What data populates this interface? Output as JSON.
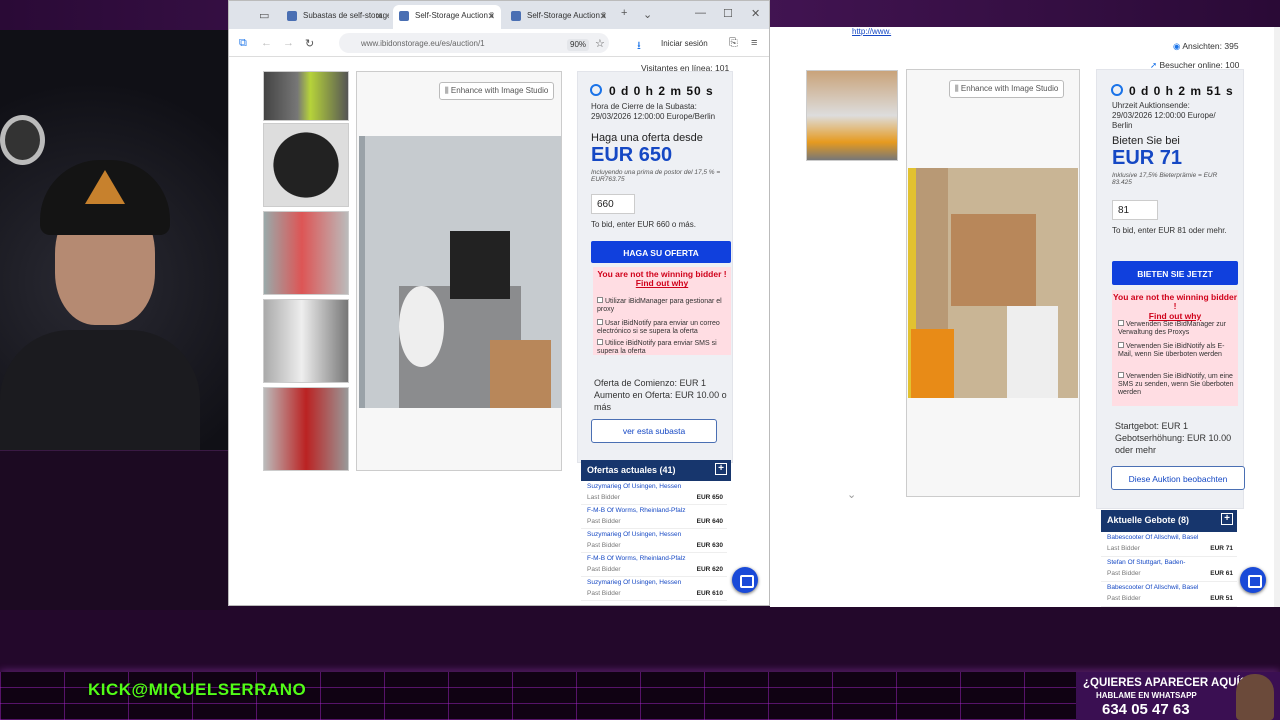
{
  "stream": {
    "overlay_handle": "KICK@MIQUELSERRANO",
    "promo": {
      "question": "¿QUIERES APARECER AQUÍ?",
      "whatsapp": "HABLAME EN WHATSAPP",
      "phone": "634 05 47 63"
    }
  },
  "browser_es": {
    "tabs": [
      {
        "label": "Subastas de self-storage"
      },
      {
        "label": "Self-Storage Auction li"
      },
      {
        "label": "Self-Storage Auction li"
      }
    ],
    "address": "www.ibidonstorage.eu/es/auction/1",
    "zoom": "90%",
    "signin": "Iniciar sesión",
    "visitors": "Visitantes en línea: 101",
    "enhance": "Enhance with Image Studio",
    "timer": "0 d 0 h 2 m 50 s",
    "close_label": "Hora de Cierre de la Subasta:",
    "close_value": "29/03/2026 12:00:00 Europe/Berlin",
    "offer_label": "Haga una oferta desde",
    "price": "EUR 650",
    "premium_note": "Incluyendo una prima de postor del 17,5 % = EUR763.75",
    "bid_input": "660",
    "bid_hint": "To bid, enter EUR 660 o más.",
    "bid_button": "HAGA SU OFERTA",
    "warning_line1": "You are not the winning bidder !",
    "warning_line2": "Find out why",
    "options": [
      "Utilizar iBidManager para gestionar el proxy",
      "Usar iBidNotify para enviar un correo electrónico si se supera la oferta",
      "Utilice iBidNotify para enviar SMS si supera la oferta"
    ],
    "start_offer": "Oferta de Comienzo: EUR 1",
    "increment": "Aumento en Oferta: EUR 10.00 o más",
    "watch_button": "ver esta subasta",
    "offers_title": "Ofertas actuales (41)",
    "offers": [
      {
        "name": "Suzymarieg Of Usingen, Hessen",
        "status": "Last Bidder",
        "amount": "EUR 650"
      },
      {
        "name": "F-M-B Of Worms, Rheinland-Pfalz",
        "status": "Past Bidder",
        "amount": "EUR 640"
      },
      {
        "name": "Suzymarieg Of Usingen, Hessen",
        "status": "Past Bidder",
        "amount": "EUR 630"
      },
      {
        "name": "F-M-B Of Worms, Rheinland-Pfalz",
        "status": "Past Bidder",
        "amount": "EUR 620"
      },
      {
        "name": "Suzymarieg Of Usingen, Hessen",
        "status": "Past Bidder",
        "amount": "EUR 610"
      }
    ]
  },
  "browser_de": {
    "link": "http://www.",
    "views": "Ansichten: 395",
    "online": "Besucher online: 100",
    "enhance": "Enhance with Image Studio",
    "timer": "0 d 0 h 2 m 51 s",
    "close_label": "Uhrzeit Auktionsende:",
    "close_value": "29/03/2026 12:00:00 Europe/ Berlin",
    "offer_label": "Bieten Sie bei",
    "price": "EUR 71",
    "premium_note": "Inklusive 17,5% Bieterprämie = EUR 83.425",
    "bid_input": "81",
    "bid_hint": "To bid, enter EUR 81 oder mehr.",
    "bid_button": "BIETEN SIE JETZT",
    "warning_line1": "You are not the winning bidder !",
    "warning_line2": "Find out why",
    "options": [
      "Verwenden Sie iBidManager zur Verwaltung des Proxys",
      "Verwenden Sie iBidNotify als E-Mail, wenn Sie überboten werden",
      "Verwenden Sie iBidNotify, um eine SMS zu senden, wenn Sie überboten werden"
    ],
    "start_offer": "Startgebot: EUR 1",
    "increment": "Gebotserhöhung: EUR 10.00 oder mehr",
    "watch_button": "Diese Auktion beobachten",
    "offers_title": "Aktuelle Gebote (8)",
    "offers": [
      {
        "name": "Babescooter Of Allschwil, Basel",
        "status": "Last Bidder",
        "amount": "EUR 71"
      },
      {
        "name": "Stefan Of Stuttgart, Baden-",
        "status": "Past Bidder",
        "amount": "EUR 61"
      },
      {
        "name": "Babescooter Of Allschwil, Basel",
        "status": "Past Bidder",
        "amount": "EUR 51"
      }
    ]
  },
  "colors": {
    "accent": "#1040dd",
    "price": "#1548c4",
    "header": "#17366d",
    "warning": "#d0021b",
    "kick": "#53fc18"
  }
}
